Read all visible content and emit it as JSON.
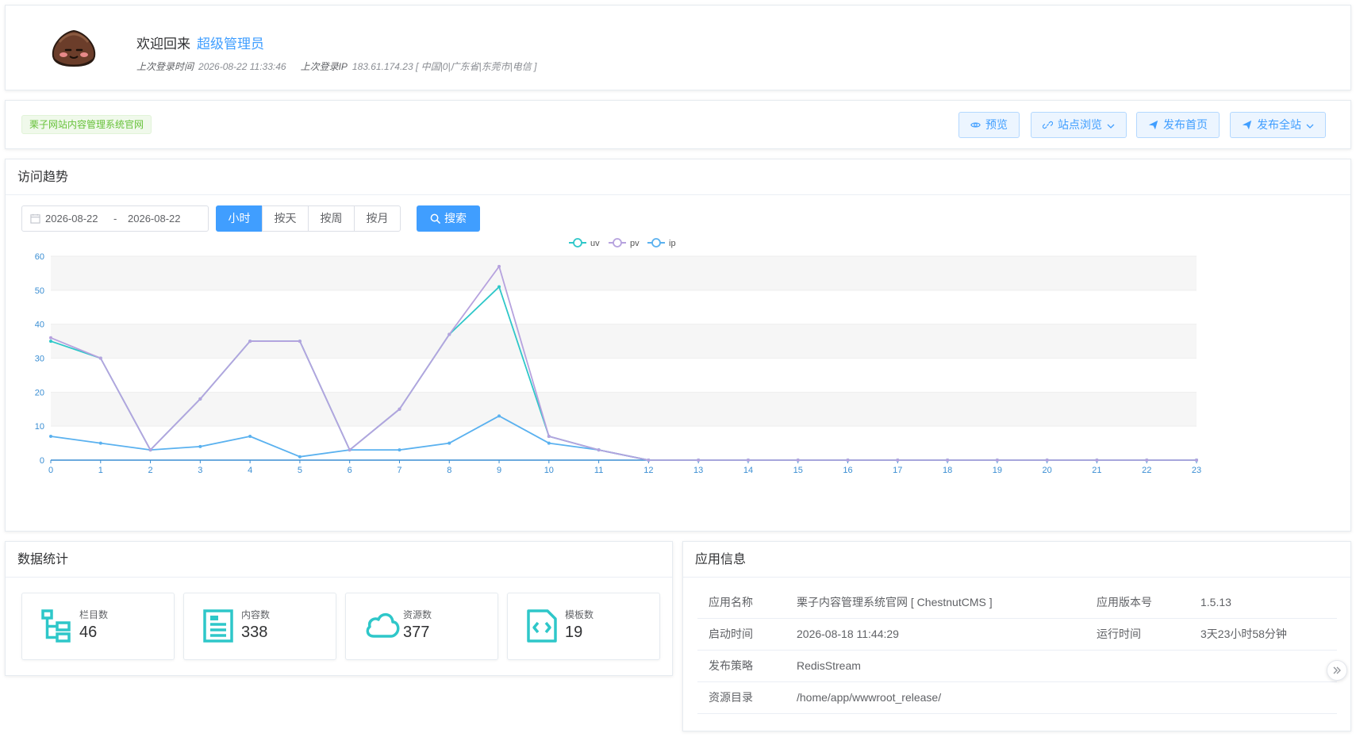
{
  "welcome": {
    "greeting": "欢迎回来",
    "username": "超级管理员",
    "last_login_time_label": "上次登录时间",
    "last_login_time": "2026-08-22 11:33:46",
    "last_login_ip_label": "上次登录IP",
    "last_login_ip": "183.61.174.23 [ 中国|0|广东省|东莞市|电信 ]"
  },
  "site": {
    "name_tag": "栗子网站内容管理系统官网",
    "buttons": {
      "preview": "预览",
      "browse": "站点浏览",
      "publish_home": "发布首页",
      "publish_all": "发布全站"
    }
  },
  "trend": {
    "title": "访问趋势",
    "date_start": "2026-08-22",
    "date_sep": "-",
    "date_end": "2026-08-22",
    "granularity": [
      "小时",
      "按天",
      "按周",
      "按月"
    ],
    "granularity_selected": "小时",
    "search_label": "搜索"
  },
  "chart_data": {
    "type": "line",
    "x": [
      "0",
      "1",
      "2",
      "3",
      "4",
      "5",
      "6",
      "7",
      "8",
      "9",
      "10",
      "11",
      "12",
      "13",
      "14",
      "15",
      "16",
      "17",
      "18",
      "19",
      "20",
      "21",
      "22",
      "23"
    ],
    "ylim": [
      0,
      60
    ],
    "yticks": [
      0,
      10,
      20,
      30,
      40,
      50,
      60
    ],
    "legend_position": "top-center",
    "series": [
      {
        "name": "uv",
        "color": "#2ec7c9",
        "values": [
          35,
          30,
          3,
          18,
          35,
          35,
          3,
          15,
          37,
          51,
          7,
          3,
          0,
          0,
          0,
          0,
          0,
          0,
          0,
          0,
          0,
          0,
          0,
          0
        ]
      },
      {
        "name": "pv",
        "color": "#b6a2de",
        "values": [
          36,
          30,
          3,
          18,
          35,
          35,
          3,
          15,
          37,
          57,
          7,
          3,
          0,
          0,
          0,
          0,
          0,
          0,
          0,
          0,
          0,
          0,
          0,
          0
        ]
      },
      {
        "name": "ip",
        "color": "#5ab1ef",
        "values": [
          7,
          5,
          3,
          4,
          7,
          1,
          3,
          3,
          5,
          13,
          5,
          3,
          0,
          0,
          0,
          0,
          0,
          0,
          0,
          0,
          0,
          0,
          0,
          0
        ]
      }
    ]
  },
  "stats": {
    "title": "数据统计",
    "items": [
      {
        "label": "栏目数",
        "value": "46",
        "icon": "tree-icon"
      },
      {
        "label": "内容数",
        "value": "338",
        "icon": "document-icon"
      },
      {
        "label": "资源数",
        "value": "377",
        "icon": "cloud-icon"
      },
      {
        "label": "模板数",
        "value": "19",
        "icon": "code-file-icon"
      }
    ]
  },
  "app_info": {
    "title": "应用信息",
    "name_label": "应用名称",
    "name_value": "栗子内容管理系统官网 [ ChestnutCMS ]",
    "version_label": "应用版本号",
    "version_value": "1.5.13",
    "start_label": "启动时间",
    "start_value": "2026-08-18 11:44:29",
    "uptime_label": "运行时间",
    "uptime_value": "3天23小时58分钟",
    "strategy_label": "发布策略",
    "strategy_value": "RedisStream",
    "dir_label": "资源目录",
    "dir_value": "/home/app/wwwroot_release/"
  },
  "colors": {
    "primary": "#409eff",
    "teal": "#2ec7c9",
    "success": "#67c23a"
  }
}
